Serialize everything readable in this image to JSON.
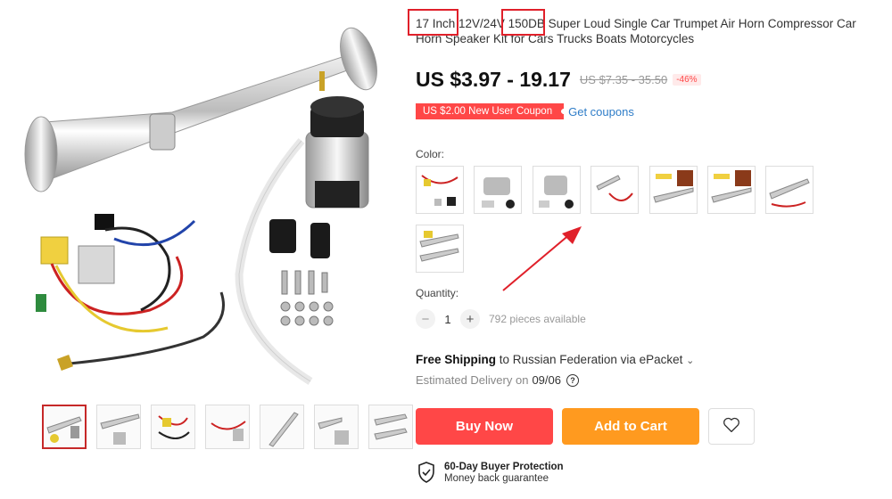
{
  "product": {
    "title": "17 Inch 12V/24V 150DB Super Loud Single Car Trumpet Air Horn Compressor Car Horn Speaker Kit for Cars Trucks Boats Motorcycles",
    "price": "US $3.97 - 19.17",
    "old_price": "US $7.35 - 35.50",
    "discount": "-46%"
  },
  "coupon": {
    "label": "US $2.00 New User Coupon",
    "link": "Get coupons"
  },
  "color": {
    "label": "Color:",
    "options": [
      "kit-with-wiring",
      "horn-compressor",
      "compressor-horn",
      "horn-wiring",
      "150db-horn",
      "150db-horn-alt",
      "horn-kit",
      "horn-pair"
    ]
  },
  "quantity": {
    "label": "Quantity:",
    "value": "1",
    "minus": "−",
    "plus": "+",
    "available": "792 pieces available"
  },
  "shipping": {
    "free": "Free Shipping",
    "dest": " to Russian Federation via ePacket",
    "chevron": "⌄",
    "delivery_label": "Estimated Delivery on",
    "delivery_date": "09/06",
    "help_icon": "?"
  },
  "actions": {
    "buy_now": "Buy Now",
    "add_to_cart": "Add to Cart"
  },
  "protection": {
    "title": "60-Day Buyer Protection",
    "subtitle": "Money back guarantee"
  },
  "colors": {
    "accent_red": "#ff4747",
    "accent_orange": "#ff9a1f",
    "link_blue": "#2f7dc8",
    "highlight_red": "#e0202a"
  }
}
